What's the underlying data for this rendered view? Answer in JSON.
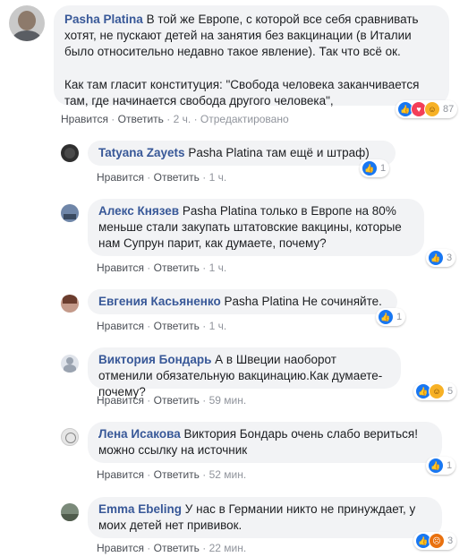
{
  "colors": {
    "author": "#385898",
    "bubble": "#f2f3f5",
    "meta": "#90949c",
    "like": "#1877f2"
  },
  "comments": [
    {
      "author": "Pasha Platina",
      "text1": "В той же Европе, с которой все себя сравнивать хотят, не пускают детей на занятия без вакцинации (в Италии было относительно недавно такое явление). Так что всё ок.",
      "text2": "Как там гласит конституция: \"Свобода человека заканчивается там, где начинается свобода другого человека\",",
      "like": "Нравится",
      "reply": "Ответить",
      "time": "2 ч.",
      "edited": "Отредактировано",
      "reactions": [
        "like-icon",
        "love-icon",
        "haha-icon"
      ],
      "count": "87"
    },
    {
      "author": "Tatyana Zayets",
      "text": "Pasha Platina там ещё и штраф)",
      "like": "Нравится",
      "reply": "Ответить",
      "time": "1 ч.",
      "reactions": [
        "like-icon"
      ],
      "count": "1"
    },
    {
      "author": "Алекс Князев",
      "text": "Pasha Platina только в Европе на 80% меньше стали закупать штатовские вакцины, которые нам Супрун парит, как думаете, почему?",
      "like": "Нравится",
      "reply": "Ответить",
      "time": "1 ч.",
      "reactions": [
        "like-icon"
      ],
      "count": "3"
    },
    {
      "author": "Евгения Касьяненко",
      "text": "Pasha Platina Не сочиняйте.",
      "like": "Нравится",
      "reply": "Ответить",
      "time": "1 ч.",
      "reactions": [
        "like-icon"
      ],
      "count": "1"
    },
    {
      "author": "Виктория Бондарь",
      "text": "А в Швеции наоборот отменили обязательную вакцинацию.Как думаете-почему?",
      "like": "Нравится",
      "reply": "Ответить",
      "time": "59 мин.",
      "reactions": [
        "like-icon",
        "haha-icon"
      ],
      "count": "5"
    },
    {
      "author": "Лена Исакова",
      "text": "Виктория Бондарь очень слабо вериться! можно ссылку на источник",
      "like": "Нравится",
      "reply": "Ответить",
      "time": "52 мин.",
      "reactions": [
        "like-icon"
      ],
      "count": "1"
    },
    {
      "author": "Emma Ebeling",
      "text": "У нас в Германии никто не принуждает, у моих детей нет прививок.",
      "like": "Нравится",
      "reply": "Ответить",
      "time": "22 мин.",
      "reactions": [
        "like-icon",
        "angry-icon"
      ],
      "count": "3"
    }
  ],
  "sep": "·"
}
